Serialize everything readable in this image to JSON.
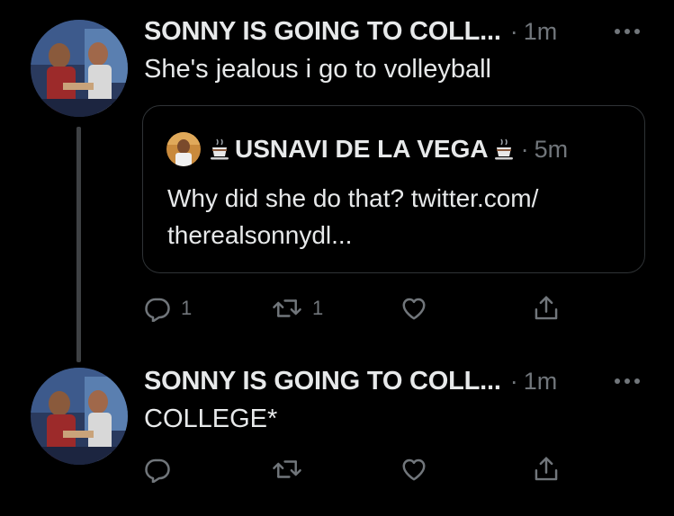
{
  "tweets": [
    {
      "author": "SONNY IS GOING TO COLL...",
      "separator": "·",
      "time": "1m",
      "text": "She's jealous i go to volleyball",
      "quote": {
        "author": "USNAVI DE LA VEGA",
        "separator": "·",
        "time": "5m",
        "text_lines": [
          "Why did she do that? twitter.com/",
          "therealsonnydl..."
        ]
      },
      "actions": {
        "reply_count": "1",
        "retweet_count": "1",
        "like_count": "",
        "share_count": ""
      }
    },
    {
      "author": "SONNY IS GOING TO COLL...",
      "separator": "·",
      "time": "1m",
      "text": "COLLEGE*",
      "actions": {
        "reply_count": "",
        "retweet_count": "",
        "like_count": "",
        "share_count": ""
      }
    }
  ],
  "icons": {
    "more": "more-dots-icon",
    "reply": "reply-icon",
    "retweet": "retweet-icon",
    "like": "heart-icon",
    "share": "share-icon",
    "emoji": "coffee-cup-emoji-icon"
  },
  "colors": {
    "background": "#000000",
    "text": "#e7e9ea",
    "secondary": "#71767b",
    "border": "#2f3336",
    "thread_line": "#3e4144"
  }
}
